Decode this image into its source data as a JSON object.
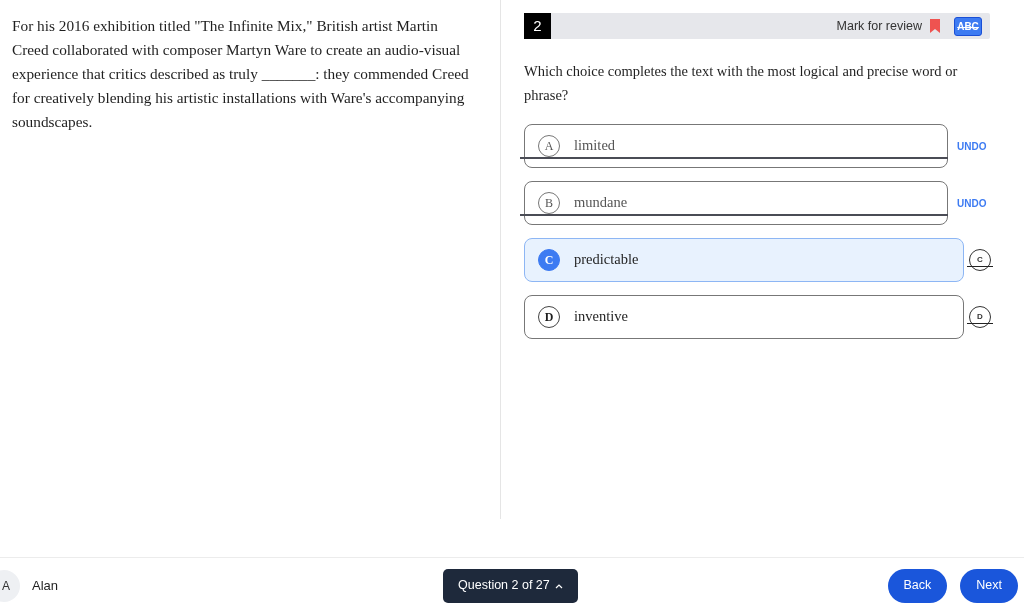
{
  "passage": "For his 2016 exhibition titled \"The Infinite Mix,\" British artist Martin Creed collaborated with composer Martyn Ware to create an audio-visual experience that critics described as truly _______: they commended Creed for creatively blending his artistic installations with Ware's accompanying soundscapes.",
  "question_header": {
    "number": "2",
    "mark_label": "Mark for review",
    "marked": true,
    "strikeout_tool": {
      "label": "ABC",
      "on": true
    }
  },
  "prompt": "Which choice completes the text with the most logical and precise word or phrase?",
  "options": [
    {
      "letter": "A",
      "text": "limited",
      "selected": false,
      "crossed_out": true,
      "undo_label": "UNDO"
    },
    {
      "letter": "B",
      "text": "mundane",
      "selected": false,
      "crossed_out": true,
      "undo_label": "UNDO"
    },
    {
      "letter": "C",
      "text": "predictable",
      "selected": true,
      "crossed_out": false,
      "cross_letter": "C"
    },
    {
      "letter": "D",
      "text": "inventive",
      "selected": false,
      "crossed_out": false,
      "cross_letter": "D"
    }
  ],
  "footer": {
    "avatar_letter": "A",
    "user_name": "Alan",
    "question_nav": "Question 2 of 27",
    "buttons": [
      "Back",
      "Next"
    ]
  }
}
